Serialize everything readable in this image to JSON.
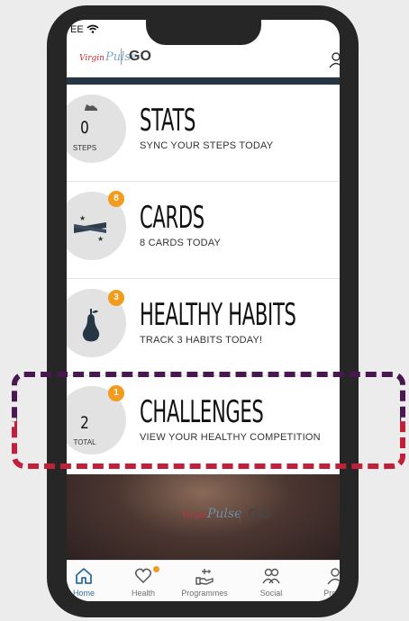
{
  "status_bar": {
    "carrier": "EE"
  },
  "header": {
    "logo_virgin": "Virgin",
    "logo_brand": "Pulse",
    "logo_go": "GO"
  },
  "cards": [
    {
      "title": "STATS",
      "subtitle": "SYNC YOUR STEPS TODAY",
      "value": "0",
      "unit": "STEPS",
      "icon": "shoe-icon"
    },
    {
      "title": "CARDS",
      "subtitle": "8 CARDS TODAY",
      "badge": "8",
      "icon": "cards-icon"
    },
    {
      "title": "HEALTHY HABITS",
      "subtitle": "TRACK 3 HABITS TODAY!",
      "badge": "3",
      "icon": "pear-icon"
    },
    {
      "title": "CHALLENGES",
      "subtitle": "VIEW YOUR HEALTHY COMPETITION",
      "badge": "1",
      "value": "2",
      "unit": "TOTAL"
    }
  ],
  "banner": {
    "logo_virgin": "Virgin",
    "logo_brand": "Pulse",
    "logo_go": "GO"
  },
  "tabbar": {
    "items": [
      {
        "label": "Home",
        "icon": "home-icon",
        "active": true
      },
      {
        "label": "Health",
        "icon": "heart-icon"
      },
      {
        "label": "Programmes",
        "icon": "hand-stars-icon"
      },
      {
        "label": "Social",
        "icon": "people-icon"
      },
      {
        "label": "Profile",
        "icon": "person-icon"
      }
    ]
  },
  "colors": {
    "header_bar": "#263645",
    "badge": "#f29b1d",
    "highlight_top": "#4a1850",
    "highlight_bottom": "#c0213a",
    "active_tab": "#2e6fa0"
  }
}
